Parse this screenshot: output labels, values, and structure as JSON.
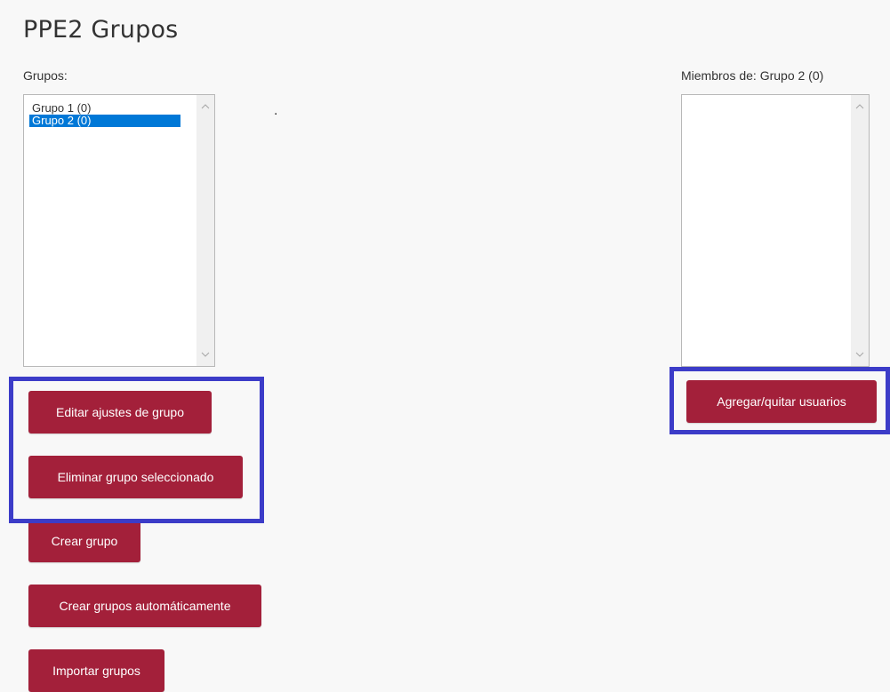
{
  "page": {
    "title": "PPE2 Grupos",
    "separator": "."
  },
  "groups_panel": {
    "label": "Grupos:",
    "items": [
      {
        "label": "Grupo 1 (0)",
        "selected": false
      },
      {
        "label": "Grupo 2 (0)",
        "selected": true
      }
    ]
  },
  "members_panel": {
    "label": "Miembros de: Grupo 2 (0)",
    "items": []
  },
  "buttons": {
    "edit_settings": "Editar ajustes de grupo",
    "delete_selected": "Eliminar grupo seleccionado",
    "create_group": "Crear grupo",
    "auto_create": "Crear grupos automáticamente",
    "import_groups": "Importar grupos",
    "add_remove_users": "Agregar/quitar usuarios"
  },
  "colors": {
    "button_bg": "#a3203a",
    "selection_bg": "#0078d7",
    "highlight_border": "#3c3cc8",
    "page_bg": "#f8f8f8"
  }
}
